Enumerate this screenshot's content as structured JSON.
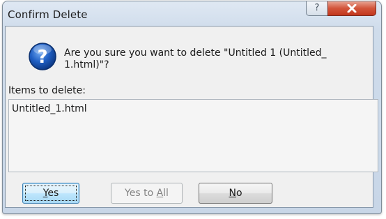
{
  "window": {
    "title": "Confirm Delete",
    "help_glyph": "?",
    "close_glyph": "x"
  },
  "message": {
    "text": "Are you sure you want to delete \"Untitled 1 (Untitled_ 1.html)\"?",
    "icon": "question-icon"
  },
  "items": {
    "label": "Items to delete:",
    "list": [
      "Untitled_1.html"
    ]
  },
  "buttons": {
    "yes_label": "Yes",
    "yes_mnemonic": "Y",
    "yes_rest": "es",
    "yes_to_all_label": "Yes to All",
    "yes_to_all_prefix": "Yes to ",
    "yes_to_all_mnemonic": "A",
    "yes_to_all_rest": "ll",
    "no_label": "No",
    "no_mnemonic": "N",
    "no_rest": "o"
  },
  "colors": {
    "close_button": "#c2361c",
    "default_button": "#3c7fb1",
    "icon_blue": "#1f5fc4"
  }
}
